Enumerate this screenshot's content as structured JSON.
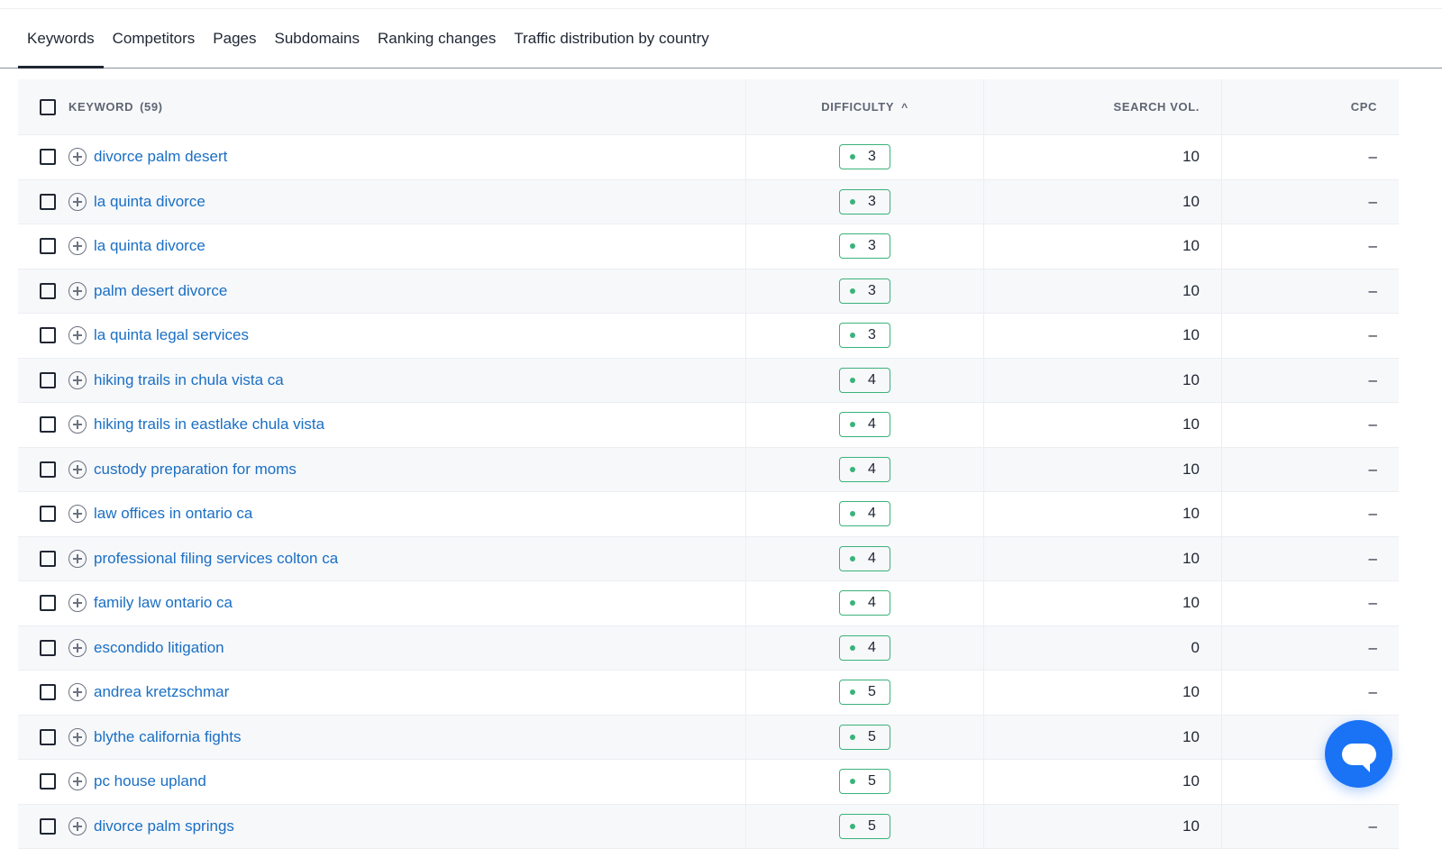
{
  "tabs": [
    {
      "label": "Keywords",
      "active": true
    },
    {
      "label": "Competitors",
      "active": false
    },
    {
      "label": "Pages",
      "active": false
    },
    {
      "label": "Subdomains",
      "active": false
    },
    {
      "label": "Ranking changes",
      "active": false
    },
    {
      "label": "Traffic distribution by country",
      "active": false
    }
  ],
  "table": {
    "headers": {
      "keyword": "KEYWORD",
      "keyword_count": "(59)",
      "difficulty": "DIFFICULTY",
      "sort_indicator": "^",
      "search_vol": "SEARCH VOL.",
      "cpc": "CPC"
    },
    "rows": [
      {
        "keyword": "divorce palm desert",
        "difficulty": "3",
        "search_vol": "10",
        "cpc": "–"
      },
      {
        "keyword": "la quinta divorce",
        "difficulty": "3",
        "search_vol": "10",
        "cpc": "–"
      },
      {
        "keyword": "la quinta divorce",
        "difficulty": "3",
        "search_vol": "10",
        "cpc": "–"
      },
      {
        "keyword": "palm desert divorce",
        "difficulty": "3",
        "search_vol": "10",
        "cpc": "–"
      },
      {
        "keyword": "la quinta legal services",
        "difficulty": "3",
        "search_vol": "10",
        "cpc": "–"
      },
      {
        "keyword": "hiking trails in chula vista ca",
        "difficulty": "4",
        "search_vol": "10",
        "cpc": "–"
      },
      {
        "keyword": "hiking trails in eastlake chula vista",
        "difficulty": "4",
        "search_vol": "10",
        "cpc": "–"
      },
      {
        "keyword": "custody preparation for moms",
        "difficulty": "4",
        "search_vol": "10",
        "cpc": "–"
      },
      {
        "keyword": "law offices in ontario ca",
        "difficulty": "4",
        "search_vol": "10",
        "cpc": "–"
      },
      {
        "keyword": "professional filing services colton ca",
        "difficulty": "4",
        "search_vol": "10",
        "cpc": "–"
      },
      {
        "keyword": "family law ontario ca",
        "difficulty": "4",
        "search_vol": "10",
        "cpc": "–"
      },
      {
        "keyword": "escondido litigation",
        "difficulty": "4",
        "search_vol": "0",
        "cpc": "–"
      },
      {
        "keyword": "andrea kretzschmar",
        "difficulty": "5",
        "search_vol": "10",
        "cpc": "–"
      },
      {
        "keyword": "blythe california fights",
        "difficulty": "5",
        "search_vol": "10",
        "cpc": ""
      },
      {
        "keyword": "pc house upland",
        "difficulty": "5",
        "search_vol": "10",
        "cpc": ""
      },
      {
        "keyword": "divorce palm springs",
        "difficulty": "5",
        "search_vol": "10",
        "cpc": "–"
      }
    ]
  },
  "colors": {
    "link": "#1a6fc4",
    "difficulty_green": "#3bb27b",
    "chat_button": "#1a73f5"
  },
  "chat": {
    "icon": "chat-bubble-icon"
  }
}
